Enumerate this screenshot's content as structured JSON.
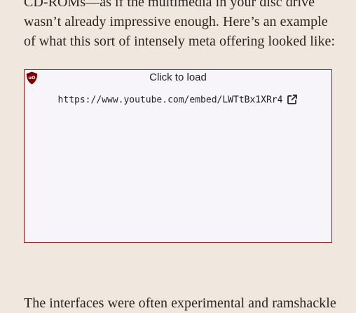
{
  "article": {
    "para_top_lines": [
      "CD-ROMs—as if the multimedia in your disc drive",
      "wasn’t already impressive enough. Here’s an example",
      "of what this sort of intensely meta offering looked like:"
    ],
    "para_bottom_line": "The interfaces were often experimental and ramshackle"
  },
  "embed": {
    "click_label": "Click to load",
    "url": "https://www.youtube.com/embed/LWTtBx1XRr4",
    "blocker_icon": "ublock-origin-shield-icon",
    "link_icon": "external-link-icon",
    "colors": {
      "border": "#8b1d1d",
      "background": "#f7f5fa",
      "shield": "#800000"
    }
  },
  "page": {
    "background": "#f0e7de"
  }
}
